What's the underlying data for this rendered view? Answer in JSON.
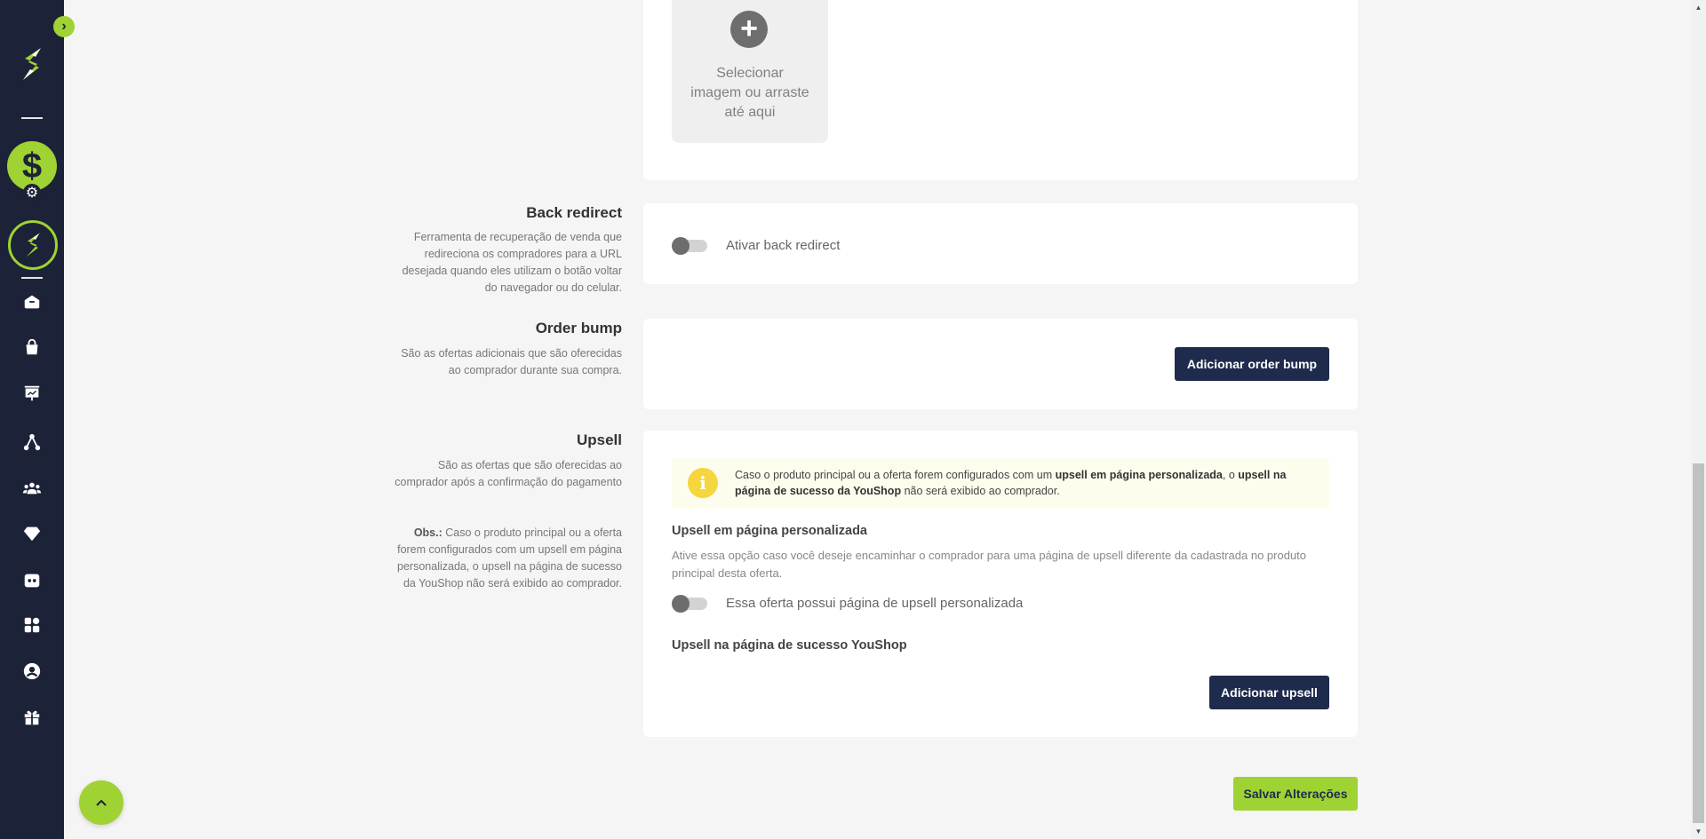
{
  "upload": {
    "text": "Selecionar imagem ou arraste até aqui"
  },
  "back_redirect": {
    "title": "Back redirect",
    "description": "Ferramenta de recuperação de venda que redireciona os compradores para a URL desejada quando eles utilizam o botão voltar do navegador ou do celular.",
    "toggle_label": "Ativar back redirect",
    "enabled": false
  },
  "order_bump": {
    "title": "Order bump",
    "description": "São as ofertas adicionais que são oferecidas ao comprador durante sua compra.",
    "button": "Adicionar order bump"
  },
  "upsell": {
    "title": "Upsell",
    "description": "São as ofertas que são oferecidas ao comprador após a confirmação do pagamento",
    "obs_label": "Obs.:",
    "obs_text": " Caso o produto principal ou a oferta forem configurados com um upsell em página personalizada, o upsell na página de sucesso da YouShop não será exibido ao comprador.",
    "alert": {
      "part1": "Caso o produto principal ou a oferta forem configurados com um ",
      "bold1": "upsell em página personalizada",
      "part2": ", o ",
      "bold2": "upsell na página de sucesso da YouShop",
      "part3": " não será exibido ao comprador."
    },
    "custom_page_title": "Upsell em página personalizada",
    "custom_page_desc": "Ative essa opção caso você deseje encaminhar o comprador para uma página de upsell diferente da cadastrada no produto principal desta oferta.",
    "custom_page_toggle_label": "Essa oferta possui página de upsell personalizada",
    "custom_page_enabled": false,
    "success_page_title": "Upsell na página de sucesso YouShop",
    "button": "Adicionar upsell"
  },
  "save_button": "Salvar Alterações",
  "sidebar": {
    "expand_glyph": "›",
    "dollar_glyph": "$",
    "gear_glyph": "⚙",
    "scroll_top_glyph": "⌃",
    "icons": [
      "home-icon",
      "bag-icon",
      "presentation-icon",
      "network-icon",
      "users-icon",
      "diamond-icon",
      "dashboard-icon",
      "apps-icon",
      "user-circle-icon",
      "gift-icon"
    ]
  },
  "colors": {
    "sidebar_bg": "#1c2237",
    "accent": "#9fd233",
    "dark_button": "#1f2b4d",
    "alert_bg": "#fdfdee",
    "alert_icon": "#f5d63c"
  }
}
